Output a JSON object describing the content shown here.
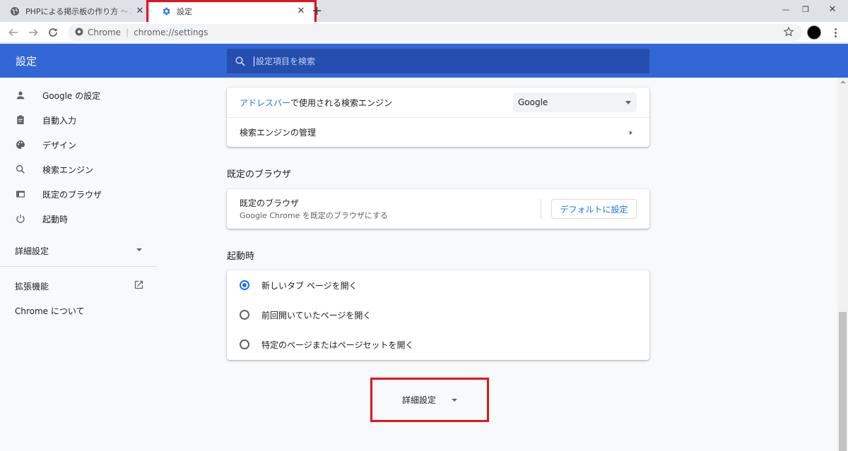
{
  "tabs": [
    {
      "title": "PHPによる掲示板の作り方 〜ここは",
      "close": "✕",
      "active": false
    },
    {
      "title": "設定",
      "close": "✕",
      "active": true
    }
  ],
  "new_tab": "+",
  "window_controls": {
    "minimize": "—",
    "restore": "❐",
    "close": "✕"
  },
  "toolbar": {
    "chip": "Chrome",
    "separator": "|",
    "url": "chrome://settings"
  },
  "header": {
    "title": "設定",
    "search_placeholder": "設定項目を検索"
  },
  "sidebar": {
    "items": [
      {
        "label": "Google の設定",
        "icon": "person-icon"
      },
      {
        "label": "自動入力",
        "icon": "clipboard-icon"
      },
      {
        "label": "デザイン",
        "icon": "palette-icon"
      },
      {
        "label": "検索エンジン",
        "icon": "search-icon"
      },
      {
        "label": "既定のブラウザ",
        "icon": "browser-icon"
      },
      {
        "label": "起動時",
        "icon": "power-icon"
      }
    ],
    "advanced": "詳細設定",
    "extensions": "拡張機能",
    "about": "Chrome について"
  },
  "search_engine": {
    "row1_link": "アドレスバー",
    "row1_text": "で使用される検索エンジン",
    "selected": "Google",
    "row2": "検索エンジンの管理"
  },
  "default_browser": {
    "section_title": "既定のブラウザ",
    "title": "既定のブラウザ",
    "subtitle": "Google Chrome を既定のブラウザにする",
    "button": "デフォルトに設定"
  },
  "startup": {
    "section_title": "起動時",
    "options": [
      {
        "label": "新しいタブ ページを開く",
        "checked": true
      },
      {
        "label": "前回開いていたページを開く",
        "checked": false
      },
      {
        "label": "特定のページまたはページセットを開く",
        "checked": false
      }
    ]
  },
  "advanced_button": "詳細設定",
  "colors": {
    "header": "#3367d6",
    "accent": "#1a73e8",
    "highlight": "#e0141e"
  }
}
